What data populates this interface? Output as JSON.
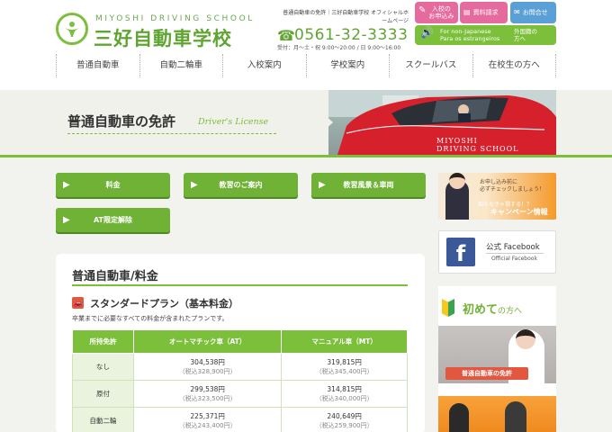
{
  "header": {
    "logo_en": "MIYOSHI DRIVING SCHOOL",
    "logo_jp": "三好自動車学校",
    "tagline": "普通自動車の免許｜三好自動車学校 オフィシャルホームページ",
    "phone_icon": "☎",
    "phone": "0561-32-3333",
    "hours": "受付：月～土・祝 9:00～20:00 / 日 9:00～16:00",
    "buttons": {
      "apply": "入校の\nお申込み",
      "brochure": "資料請求",
      "contact": "お問合せ"
    },
    "foreign": {
      "en": "For non-Japanese\nPara os estrangeiros",
      "jp": "外国籍の\n方へ"
    }
  },
  "nav": [
    "普通自動車",
    "自動二輪車",
    "入校案内",
    "学校案内",
    "スクールバス",
    "在校生の方へ"
  ],
  "hero": {
    "title": "普通自動車の免許",
    "subtitle": "Driver's License",
    "car_text": "MIYOSHI\nDRIVING SCHOOL"
  },
  "section_buttons": [
    "料金",
    "教習のご案内",
    "教習風景＆車両",
    "AT限定解除"
  ],
  "fees": {
    "title": "普通自動車/料金",
    "plan_title": "スタンダードプラン（基本料金）",
    "plan_desc": "卒業までに必要なすべての料金が含まれたプランです。",
    "columns": [
      "所持免許",
      "オートマチック車（AT）",
      "マニュアル車（MT）"
    ],
    "rows": [
      {
        "license": "なし",
        "at": "304,538円",
        "at_tax": "（税込328,900円）",
        "mt": "319,815円",
        "mt_tax": "（税込345,400円）"
      },
      {
        "license": "原付",
        "at": "299,538円",
        "at_tax": "（税込323,500円）",
        "mt": "314,815円",
        "mt_tax": "（税込340,000円）"
      },
      {
        "license": "自動二輪",
        "at": "225,371円",
        "at_tax": "（税込243,400円）",
        "mt": "240,649円",
        "mt_tax": "（税込259,900円）"
      }
    ]
  },
  "sidebar": {
    "campaign": {
      "line1": "お申し込み前に\n必ずチェックしましょう！",
      "line2": "知らなきゃ損する！？",
      "line3": "キャンペーン情報"
    },
    "facebook": {
      "icon": "f",
      "title": "公式 Facebook",
      "subtitle": "Official Facebook"
    },
    "beginner": {
      "title": "初めて",
      "suffix": "の方へ",
      "promo1": "普通自動車の免許"
    }
  },
  "colors": {
    "brand_green": "#7bbf3a",
    "button_green": "#6fb236",
    "pink": "#e56a9d",
    "blue": "#5a9fd6",
    "accent_red": "#e2573f"
  }
}
